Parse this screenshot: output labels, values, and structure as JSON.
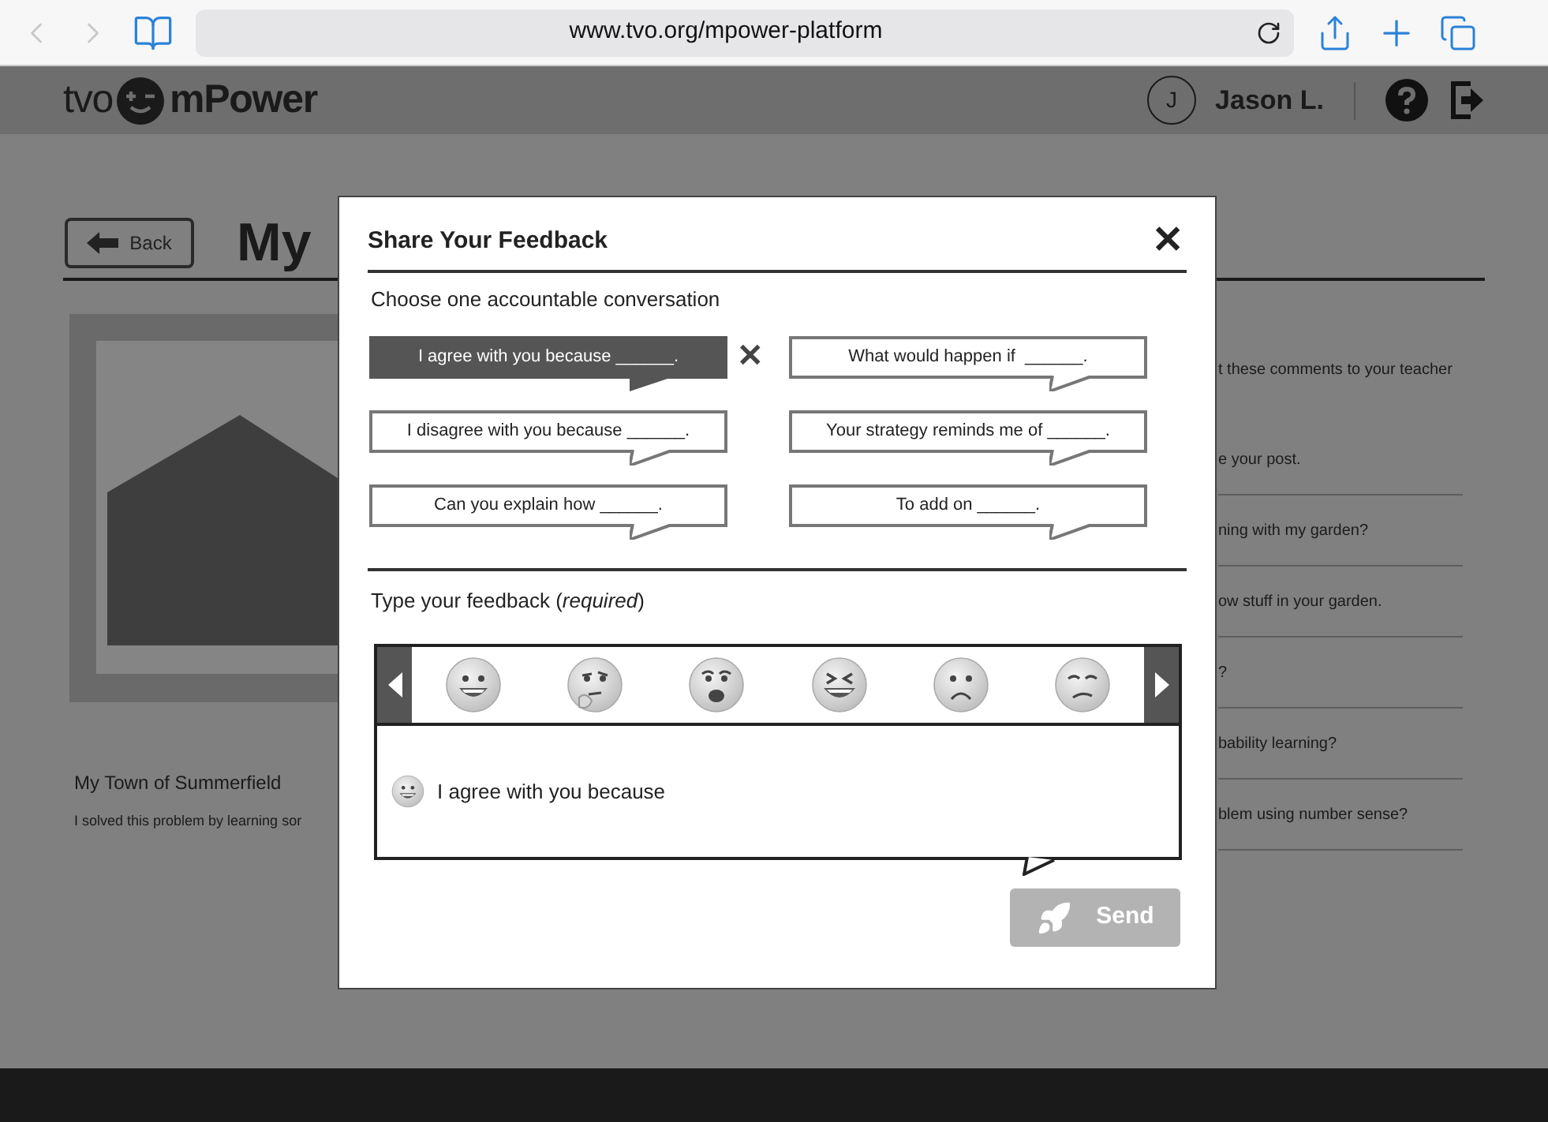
{
  "browser": {
    "url": "www.tvo.org/mpower-platform"
  },
  "header": {
    "logo_left": "tvo",
    "logo_right": "mPower",
    "avatar_initial": "J",
    "user_name": "Jason L."
  },
  "page": {
    "back_button": "Back",
    "title": "My",
    "post": {
      "title": "My Town of Summerfield",
      "text": "I solved this problem by learning sor"
    },
    "sidebar_intro": "t these comments to your teacher",
    "comments": [
      "e your post.",
      "ning with my garden?",
      "ow stuff in your garden.",
      "?",
      "bability learning?",
      "blem using number sense?"
    ]
  },
  "dialog": {
    "title": "Share Your Feedback",
    "close": "✕",
    "prompt": "Choose one accountable conversation",
    "options": [
      {
        "text": "I agree with you because ______.",
        "selected": true
      },
      {
        "text": "What would happen if  ______.",
        "selected": false
      },
      {
        "text": "I disagree with you because ______.",
        "selected": false
      },
      {
        "text": "Your strategy reminds me of ______.",
        "selected": false
      },
      {
        "text": "Can you explain how ______.",
        "selected": false
      },
      {
        "text": "To add on ______.",
        "selected": false
      }
    ],
    "remove": "✕",
    "feedback_label": "Type your feedback (*required*)",
    "emojis": [
      {
        "kind": "grin"
      },
      {
        "kind": "think"
      },
      {
        "kind": "shock"
      },
      {
        "kind": "laugh"
      },
      {
        "kind": "frown"
      },
      {
        "kind": "smirk"
      }
    ],
    "feedback": {
      "emoji": {
        "kind": "grin"
      },
      "value": "I agree with you because"
    },
    "send": "Send"
  }
}
